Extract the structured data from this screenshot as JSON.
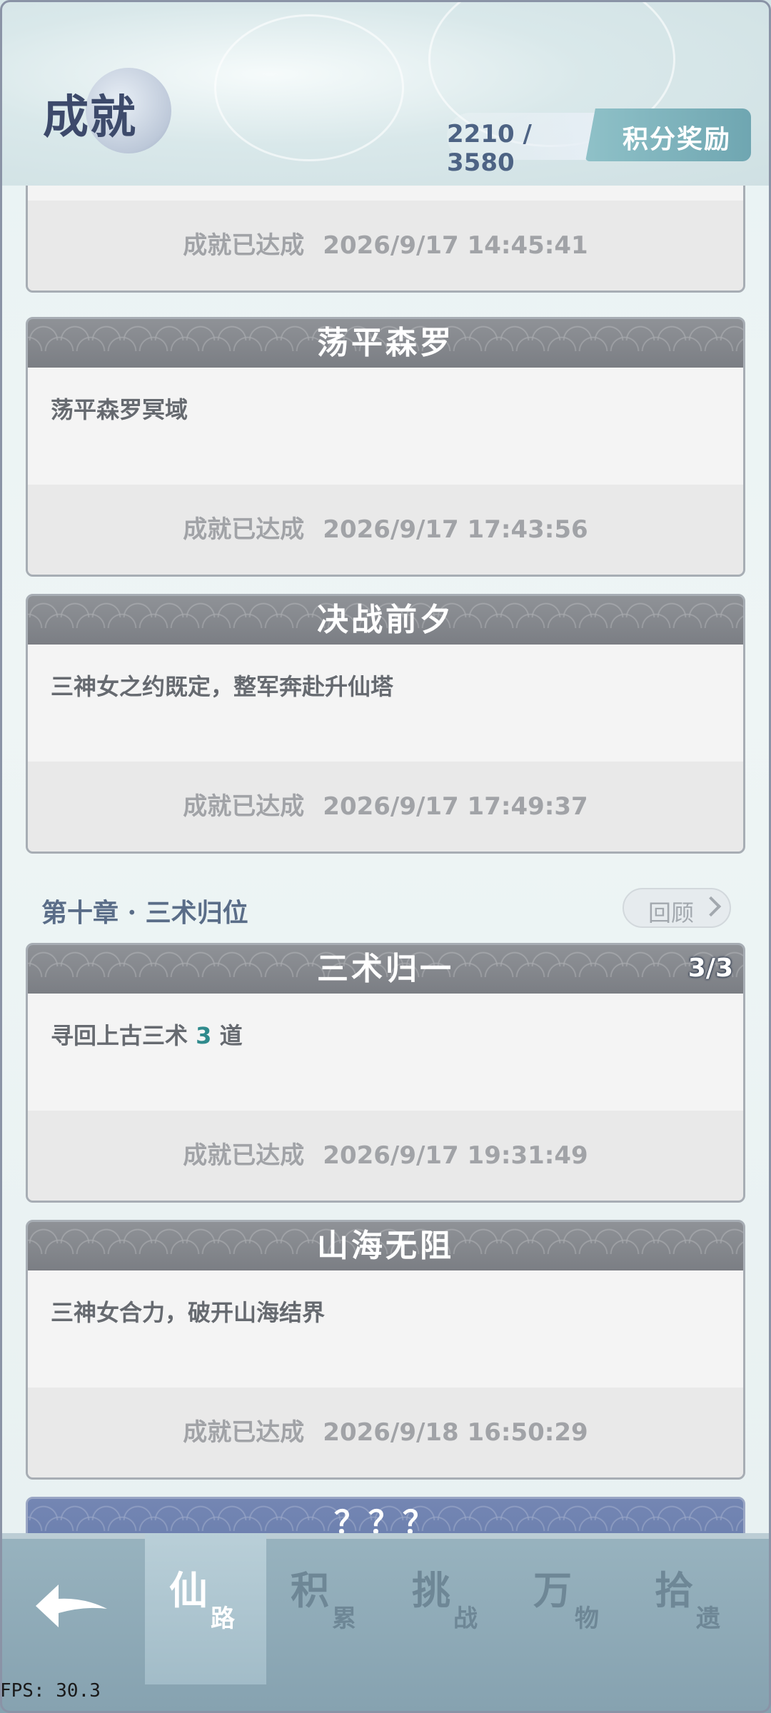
{
  "header": {
    "title": "成就",
    "score": "2210 / 3580",
    "reward_button": "积分奖励"
  },
  "status_label": "成就已达成",
  "cards": [
    {
      "title": "",
      "desc": "",
      "date": "2026/9/17 14:45:41"
    },
    {
      "title": "荡平森罗",
      "desc": "荡平森罗冥域",
      "date": "2026/9/17 17:43:56"
    },
    {
      "title": "决战前夕",
      "desc": "三神女之约既定，整军奔赴升仙塔",
      "date": "2026/9/17 17:49:37"
    },
    {
      "title": "三术归一",
      "progress": "3/3",
      "desc_prefix": "寻回上古三术 ",
      "desc_num": "3",
      "desc_suffix": " 道",
      "date": "2026/9/17 19:31:49"
    },
    {
      "title": "山海无阻",
      "desc": "三神女合力，破开山海结界",
      "date": "2026/9/18 16:50:29"
    },
    {
      "title": "？？？"
    }
  ],
  "chapter": {
    "title": "第十章 · 三术归位",
    "review_button": "回顾"
  },
  "nav": {
    "tabs": [
      {
        "main": "仙",
        "sub": "路"
      },
      {
        "main": "积",
        "sub": "累"
      },
      {
        "main": "挑",
        "sub": "战"
      },
      {
        "main": "万",
        "sub": "物"
      },
      {
        "main": "拾",
        "sub": "遗"
      }
    ]
  },
  "fps": "FPS: 30.3"
}
